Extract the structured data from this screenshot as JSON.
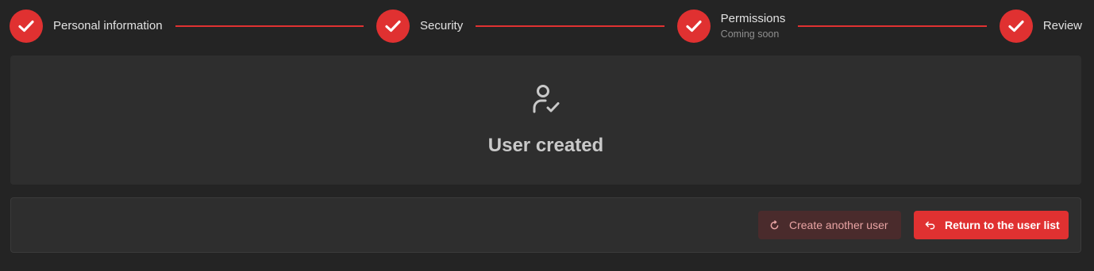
{
  "stepper": {
    "steps": [
      {
        "label": "Personal information",
        "description": "",
        "status": "completed"
      },
      {
        "label": "Security",
        "description": "",
        "status": "completed"
      },
      {
        "label": "Permissions",
        "description": "Coming soon",
        "status": "completed"
      },
      {
        "label": "Review",
        "description": "",
        "status": "completed"
      }
    ],
    "accent_color": "#e03131",
    "step_icon": "check-icon"
  },
  "result": {
    "icon": "user-check-icon",
    "title": "User created"
  },
  "actions": {
    "create_another_label": "Create another user",
    "create_another_icon": "refresh-icon",
    "return_label": "Return to the user list",
    "return_icon": "return-arrow-icon"
  }
}
